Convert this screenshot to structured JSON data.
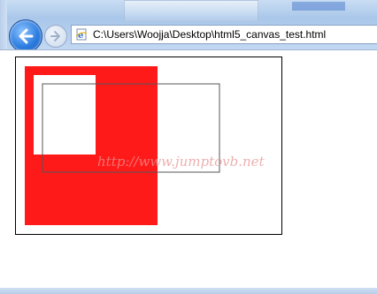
{
  "browser": {
    "address": "C:\\Users\\Woojja\\Desktop\\html5_canvas_test.html",
    "back_icon": "back-arrow-icon",
    "forward_icon": "forward-arrow-icon",
    "page_icon": "ie-page-icon"
  },
  "canvas": {
    "colors": {
      "fill": "#ff1a1a",
      "clear": "#ffffff",
      "stroke": "#555555",
      "border": "#000000"
    }
  },
  "watermark": {
    "text": "http://www.jumptovb.net"
  }
}
